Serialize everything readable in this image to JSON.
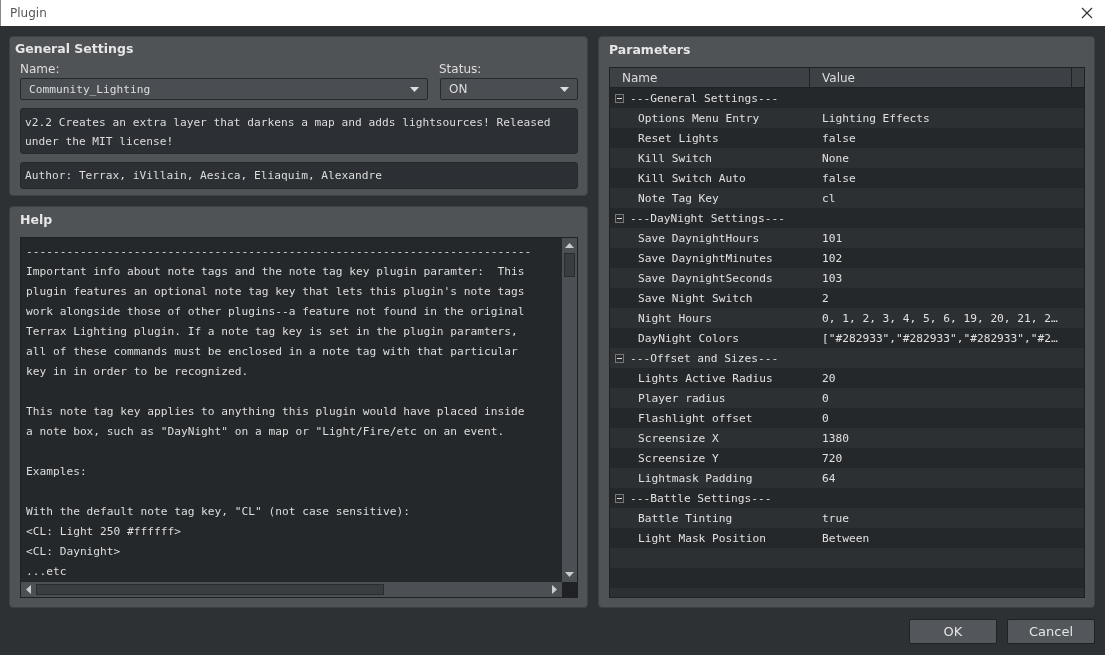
{
  "window": {
    "title": "Plugin"
  },
  "general_settings": {
    "title": "General Settings",
    "name_label": "Name:",
    "name_value": "Community_Lighting",
    "status_label": "Status:",
    "status_value": "ON",
    "description": "v2.2 Creates an extra layer that darkens a map and adds lightsources! Released\nunder the MIT license!",
    "author": "Author: Terrax, iVillain, Aesica, Eliaquim, Alexandre"
  },
  "help": {
    "title": "Help",
    "paragraphs": [
      "---------------------------------------------------------------------------\nImportant info about note tags and the note tag key plugin paramter:  This\nplugin features an optional note tag key that lets this plugin's note tags\nwork alongside those of other plugins--a feature not found in the original\nTerrax Lighting plugin. If a note tag key is set in the plugin paramters,\nall of these commands must be enclosed in a note tag with that particular\nkey in in order to be recognized.",
      "This note tag key applies to anything this plugin would have placed inside\na note box, such as \"DayNight\" on a map or \"Light/Fire/etc on an event.",
      "Examples:",
      "With the default note tag key, \"CL\" (not case sensitive):\n<CL: Light 250 #ffffff>\n<CL: Daynight>\n...etc"
    ]
  },
  "parameters": {
    "title": "Parameters",
    "columns": [
      "Name",
      "Value"
    ],
    "groups": [
      {
        "name": "---General Settings---",
        "expanded": true,
        "children": [
          {
            "name": "Options Menu Entry",
            "value": "Lighting Effects"
          },
          {
            "name": "Reset Lights",
            "value": "false"
          },
          {
            "name": "Kill Switch",
            "value": "None"
          },
          {
            "name": "Kill Switch Auto",
            "value": "false"
          },
          {
            "name": "Note Tag Key",
            "value": "cl"
          }
        ]
      },
      {
        "name": "---DayNight Settings---",
        "expanded": true,
        "children": [
          {
            "name": "Save DaynightHours",
            "value": "101"
          },
          {
            "name": "Save DaynightMinutes",
            "value": "102"
          },
          {
            "name": "Save DaynightSeconds",
            "value": "103"
          },
          {
            "name": "Save Night Switch",
            "value": "2"
          },
          {
            "name": "Night Hours",
            "value": "0, 1, 2, 3, 4, 5, 6, 19, 20, 21, 2…"
          },
          {
            "name": "DayNight Colors",
            "value": "[\"#282933\",\"#282933\",\"#282933\",\"#2…"
          }
        ]
      },
      {
        "name": "---Offset and Sizes---",
        "expanded": true,
        "children": [
          {
            "name": "Lights Active Radius",
            "value": "20"
          },
          {
            "name": "Player radius",
            "value": "0"
          },
          {
            "name": "Flashlight offset",
            "value": "0"
          },
          {
            "name": "Screensize X",
            "value": "1380"
          },
          {
            "name": "Screensize Y",
            "value": "720"
          },
          {
            "name": "Lightmask Padding",
            "value": "64"
          }
        ]
      },
      {
        "name": "---Battle Settings---",
        "expanded": true,
        "children": [
          {
            "name": "Battle Tinting",
            "value": "true"
          },
          {
            "name": "Light Mask Position",
            "value": "Between"
          }
        ]
      }
    ]
  },
  "buttons": [
    "OK",
    "Cancel"
  ]
}
